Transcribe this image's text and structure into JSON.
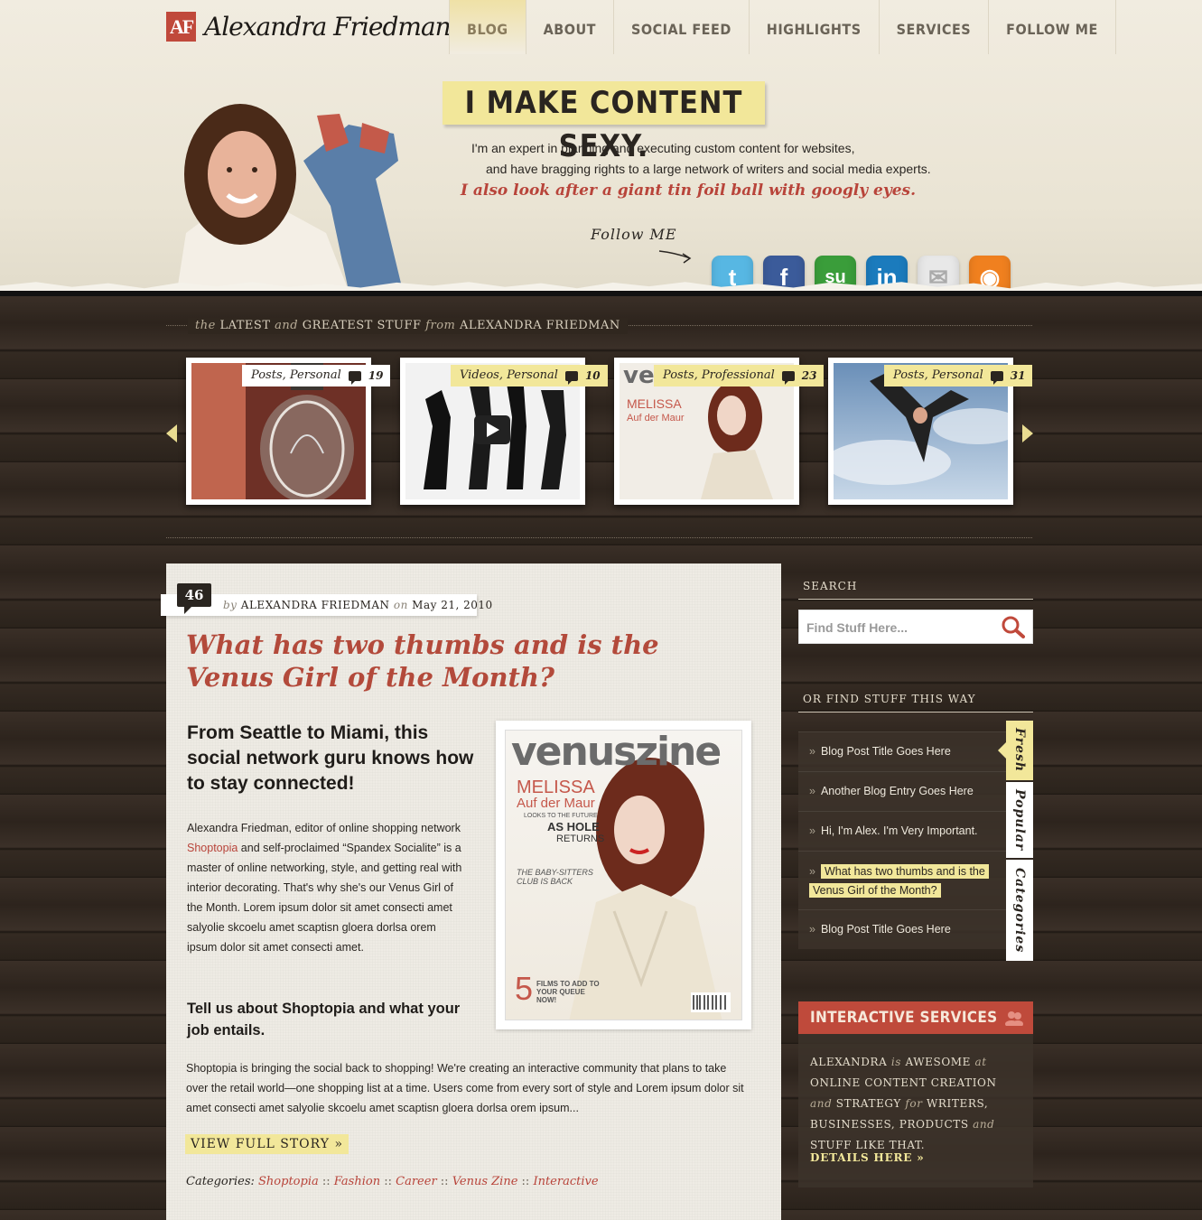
{
  "brand": {
    "logo_mark": "AF",
    "name": "Alexandra Friedman"
  },
  "nav": [
    {
      "label": "BLOG",
      "active": true
    },
    {
      "label": "ABOUT"
    },
    {
      "label": "SOCIAL FEED"
    },
    {
      "label": "HIGHLIGHTS"
    },
    {
      "label": "SERVICES"
    },
    {
      "label": "FOLLOW ME"
    }
  ],
  "hero": {
    "tagline": "I MAKE CONTENT SEXY.",
    "intro_line1": "I'm an expert in planning and executing custom content for websites,",
    "intro_line2": "and have bragging rights to a large network of writers and social media experts.",
    "intro_line3": "I also look after a giant tin foil ball with googly eyes.",
    "follow_label": "Follow ME",
    "social": [
      {
        "name": "twitter",
        "glyph": "t",
        "color": "#57b7e3"
      },
      {
        "name": "facebook",
        "glyph": "f",
        "color": "#3b5b9a"
      },
      {
        "name": "stumbleupon",
        "glyph": "su",
        "color": "#3a9d3a"
      },
      {
        "name": "linkedin",
        "glyph": "in",
        "color": "#1b7bbd"
      },
      {
        "name": "email",
        "glyph": "✉",
        "color": "#e8e8e8"
      },
      {
        "name": "rss",
        "glyph": "◉",
        "color": "#f0801f"
      }
    ]
  },
  "latest": {
    "label_pre": "the",
    "label_a": "LATEST",
    "label_and": "and",
    "label_b": "GREATEST STUFF",
    "label_from": "from",
    "label_c": "ALEXANDRA FRIEDMAN",
    "cards": [
      {
        "tag": "Posts, Personal",
        "count": "19",
        "image": "light-bulb"
      },
      {
        "tag": "Videos, Personal",
        "count": "10",
        "image": "dancers-video"
      },
      {
        "tag": "Posts, Professional",
        "count": "23",
        "image": "magazine-cover"
      },
      {
        "tag": "Posts, Personal",
        "count": "31",
        "image": "yoga-pose"
      }
    ]
  },
  "post": {
    "comments": "46",
    "by": "by",
    "author": "ALEXANDRA FRIEDMAN",
    "on": "on",
    "date": "May 21, 2010",
    "title": "What has two thumbs and is the Venus Girl of the Month?",
    "subhead": "From Seattle to Miami, this social network guru knows how to stay connected!",
    "body1_a": "Alexandra Friedman, editor of online shopping network ",
    "body1_link": "Shoptopia",
    "body1_b": " and self-proclaimed “Spandex Socialite” is a master of online networking, style, and getting real with interior decorating. That's why she's our Venus Girl of the Month. Lorem ipsum dolor sit amet consecti amet salyolie skcoelu amet scaptisn gloera dorlsa orem ipsum dolor sit amet consecti amet.",
    "subhead2": "Tell us about Shoptopia and what your job entails.",
    "body2": "Shoptopia is bringing the social back to shopping! We're creating an interactive community that plans to take over the retail world—one shopping list at a time. Users come from every sort of style and Lorem ipsum dolor sit amet consecti amet salyolie skcoelu amet scaptisn gloera dorlsa orem ipsum...",
    "read_more": "VIEW FULL STORY »",
    "categories_label": "Categories:",
    "categories": [
      "Shoptopia",
      "Fashion",
      "Career",
      "Venus Zine",
      "Interactive"
    ],
    "magazine": {
      "masthead": "venuszine",
      "cover_name_1": "MELISSA",
      "cover_name_2": "Auf der Maur",
      "cover_line_1": "LOOKS TO THE FUTURE",
      "cover_line_2": "AS HOLE",
      "cover_line_3": "RETURNS",
      "cover_line_4": "THE BABY-SITTERS",
      "cover_line_5": "CLUB IS BACK",
      "cover_line_6": "5",
      "cover_line_7": "FILMS TO ADD TO YOUR QUEUE NOW!"
    }
  },
  "sidebar": {
    "search_heading": "SEARCH",
    "search_placeholder": "Find Stuff Here...",
    "find_heading": "OR FIND STUFF THIS WAY",
    "items": [
      {
        "label": "Blog Post Title Goes Here"
      },
      {
        "label": "Another Blog Entry Goes Here"
      },
      {
        "label": "Hi, I'm Alex. I'm Very Important."
      },
      {
        "label": "What has two thumbs and is the Venus Girl of the Month?",
        "highlighted": true
      },
      {
        "label": "Blog Post Title Goes Here"
      }
    ],
    "tabs": [
      {
        "label": "Fresh",
        "active": true
      },
      {
        "label": "Popular"
      },
      {
        "label": "Categories"
      }
    ],
    "services": {
      "heading": "INTERACTIVE SERVICES",
      "t1": "ALEXANDRA",
      "i1": "is",
      "t2": "AWESOME",
      "i2": "at",
      "t3": "ONLINE CONTENT CREATION",
      "i3": "and",
      "t4": "STRATEGY",
      "i4": "for",
      "t5": "WRITERS, BUSINESSES, PRODUCTS",
      "i5": "and",
      "t6": "STUFF LIKE THAT.",
      "link": "DETAILS HERE »"
    }
  }
}
